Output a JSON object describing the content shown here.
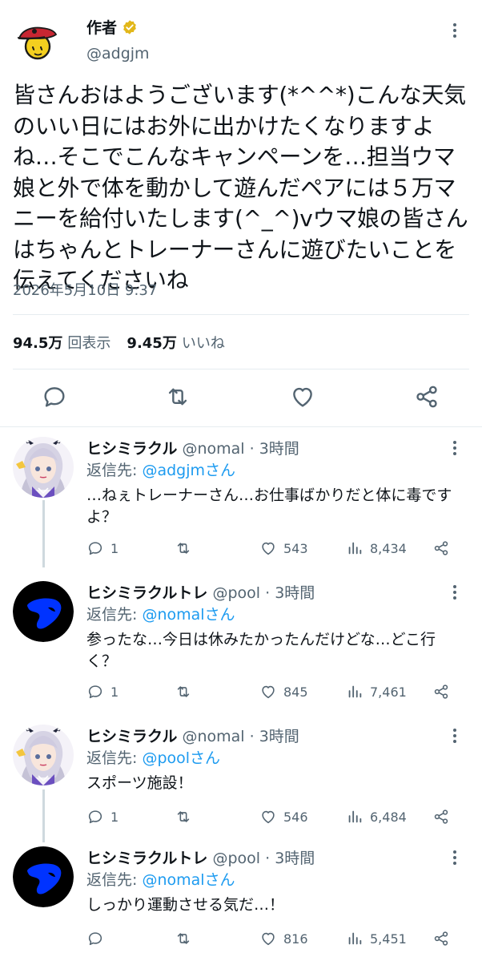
{
  "tweet": {
    "author_name": "作者",
    "author_handle": "@adgjm",
    "text": "皆さんおはようございます(*^^*)こんな天気のいい日にはお外に出かけたくなりますよね…そこでこんなキャンペーンを…担当ウマ娘と外で体を動かして遊んだペアには５万マニーを給付いたします(^_^)vウマ娘の皆さんはちゃんとトレーナーさんに遊びたいことを伝えてくださいね",
    "date": "2026年5月10日 9:37",
    "views_count": "94.5万",
    "views_label": "回表示",
    "likes_count": "9.45万",
    "likes_label": "いいね"
  },
  "icons": {
    "more": "more-dots-icon",
    "reply": "reply-bubble-icon",
    "retweet": "retweet-icon",
    "like": "heart-icon",
    "views": "views-bar-icon",
    "share": "share-icon",
    "verified": "verified-badge-icon"
  },
  "colors": {
    "link": "#1d9bf0",
    "secondary": "#536471",
    "verified": "#e2b719",
    "avatar_blue": "#0033ff"
  },
  "replies": [
    {
      "name": "ヒシミラクル",
      "handle": "@nomal",
      "time": "· 3時間",
      "reply_to_prefix": "返信先: ",
      "reply_to": "@adgjmさん",
      "text": "…ねぇトレーナーさん…お仕事ばかりだと体に毒ですよ？",
      "replies": "1",
      "likes": "543",
      "views": "8,434"
    },
    {
      "name": "ヒシミラクルトレ",
      "handle": "@pool",
      "time": "· 3時間",
      "reply_to_prefix": "返信先: ",
      "reply_to": "@nomalさん",
      "text": "参ったな…今日は休みたかったんだけどな…どこ行く？",
      "replies": "1",
      "likes": "845",
      "views": "7,461"
    },
    {
      "name": "ヒシミラクル",
      "handle": "@nomal",
      "time": "· 3時間",
      "reply_to_prefix": "返信先: ",
      "reply_to": "@poolさん",
      "text": "スポーツ施設！",
      "replies": "1",
      "likes": "546",
      "views": "6,484"
    },
    {
      "name": "ヒシミラクルトレ",
      "handle": "@pool",
      "time": "· 3時間",
      "reply_to_prefix": "返信先: ",
      "reply_to": "@nomalさん",
      "text": "しっかり運動させる気だ…！",
      "replies": "",
      "likes": "816",
      "views": "5,451"
    }
  ]
}
